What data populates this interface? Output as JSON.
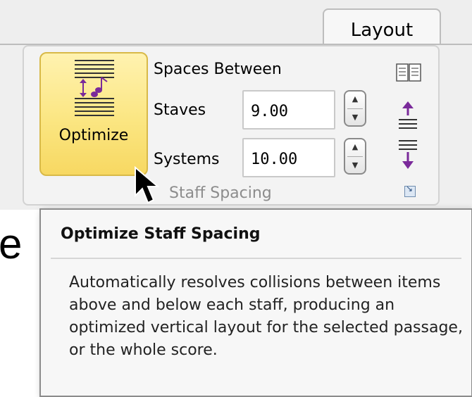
{
  "tabs": {
    "layout": "Layout"
  },
  "optimize": {
    "label": "Optimize"
  },
  "spacing": {
    "header": "Spaces Between",
    "staves_label": "Staves",
    "staves_value": "9.00",
    "systems_label": "Systems",
    "systems_value": "10.00"
  },
  "group": {
    "title": "Staff Spacing"
  },
  "tooltip": {
    "title": "Optimize Staff Spacing",
    "body": "Automatically resolves collisions between items above and below each staff, producing an optimized vertical layout for the selected passage, or the whole score."
  },
  "background_text": "e",
  "icons": {
    "optimize": "staff-optimize-icon",
    "two_columns": "two-columns-icon",
    "increase_spacing": "move-staves-up-icon",
    "decrease_spacing": "move-staves-down-icon",
    "launcher": "dialog-launcher-icon",
    "cursor": "mouse-pointer-icon"
  },
  "colors": {
    "button_highlight": "#fbe682",
    "button_border": "#d8b948",
    "arrow_purple": "#7a2a9a",
    "tooltip_bg": "#f7f7f7"
  }
}
